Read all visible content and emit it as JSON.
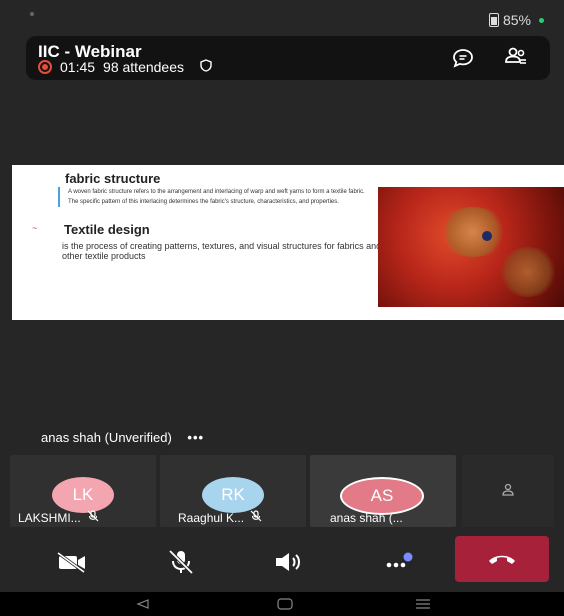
{
  "status": {
    "battery": "85%"
  },
  "header": {
    "title": "IIC - Webinar",
    "timer": "01:45",
    "attendees": "98 attendees"
  },
  "slide": {
    "heading1": "fabric structure",
    "bullet1": "A woven fabric structure refers to the arrangement and interlacing of warp and weft yarns to form a textile fabric.",
    "bullet2": "The specific pattern of this interlacing determines the fabric's structure, characteristics, and properties.",
    "heading2": "Textile design",
    "paragraph": "is the process of creating patterns, textures, and visual structures for fabrics and other textile products"
  },
  "active_speaker": {
    "name": "anas shah (Unverified)",
    "more": "•••"
  },
  "participants": [
    {
      "initials": "LK",
      "name": "LAKSHMI...",
      "color": "#f3a6b0"
    },
    {
      "initials": "RK",
      "name": "Raaghul K...",
      "color": "#a8d4ee"
    },
    {
      "initials": "AS",
      "name": "anas shah (...",
      "color": "#e27a88"
    }
  ],
  "colors": {
    "end_call": "#a8213a",
    "accent": "#e74c3c"
  }
}
